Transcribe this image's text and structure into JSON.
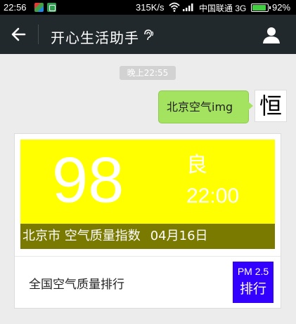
{
  "status_bar": {
    "time": "22:56",
    "speed": "315K/s",
    "carrier": "中国联通 3G",
    "battery": "92%",
    "battery_level": 0.92,
    "icons": [
      "app-notification-icon",
      "wechat-notification-icon",
      "wifi-icon",
      "signal-icon",
      "battery-icon"
    ]
  },
  "header": {
    "title": "开心生活助手",
    "back_icon": "arrow-left-icon",
    "voice_icon": "earpiece-icon",
    "contact_icon": "person-icon"
  },
  "chat": {
    "timestamp": "晚上22:55",
    "message": "北京空气img",
    "avatar_char": "恒"
  },
  "card": {
    "aqi": "98",
    "level": "良",
    "hour": "22:00",
    "caption": "北京市 空气质量指数",
    "date": "04月16日",
    "rank_label": "全国空气质量排行",
    "rank_button_line1": "PM 2.5",
    "rank_button_line2": "排行",
    "colors": {
      "aqi_panel": "#ffff00",
      "caption_bar": "#7a7a00",
      "rank_button": "#3300ff",
      "bubble": "#a4e35f",
      "header": "#22292c"
    }
  }
}
